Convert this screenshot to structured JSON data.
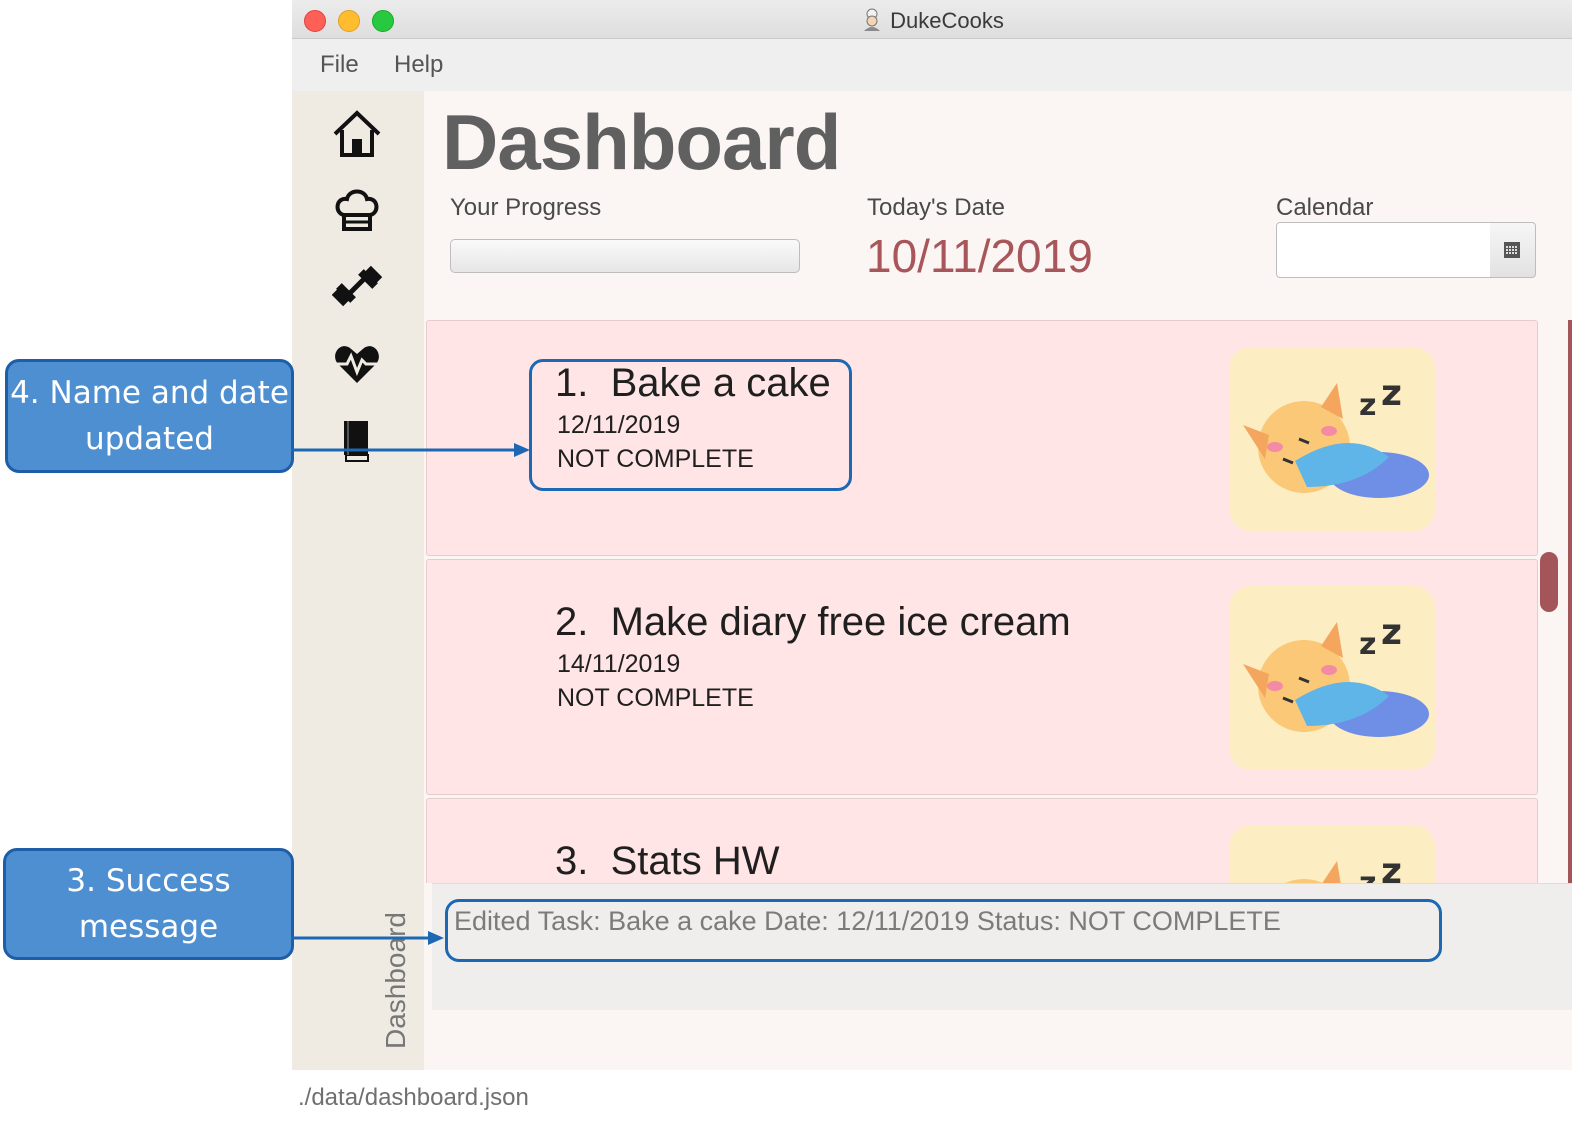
{
  "window": {
    "title": "DukeCooks"
  },
  "menu": {
    "file": "File",
    "help": "Help"
  },
  "sidebar": {
    "icons": [
      "home-icon",
      "chef-hat-icon",
      "dumbbell-icon",
      "heartbeat-icon",
      "book-icon"
    ],
    "tab_label": "Dashboard"
  },
  "dashboard": {
    "title": "Dashboard",
    "progress_label": "Your Progress",
    "progress_value": 0,
    "date_label": "Today's Date",
    "date_value": "10/11/2019",
    "calendar_label": "Calendar",
    "calendar_value": ""
  },
  "tasks": [
    {
      "title": "1.  Bake a cake",
      "date": "12/11/2019",
      "status": "NOT COMPLETE"
    },
    {
      "title": "2.  Make diary free ice cream",
      "date": "14/11/2019",
      "status": "NOT COMPLETE"
    },
    {
      "title": "3.  Stats HW"
    }
  ],
  "result_message": "Edited Task: Bake a cake Date: 12/11/2019 Status: NOT COMPLETE",
  "status_bar": "./data/dashboard.json",
  "annotations": {
    "name_date": "4. Name and date updated",
    "success": "3. Success message"
  },
  "colors": {
    "accent": "#a4555a",
    "card_bg": "#ffe5e5",
    "callout": "#4e8fd1",
    "callout_border": "#1e5da8"
  }
}
